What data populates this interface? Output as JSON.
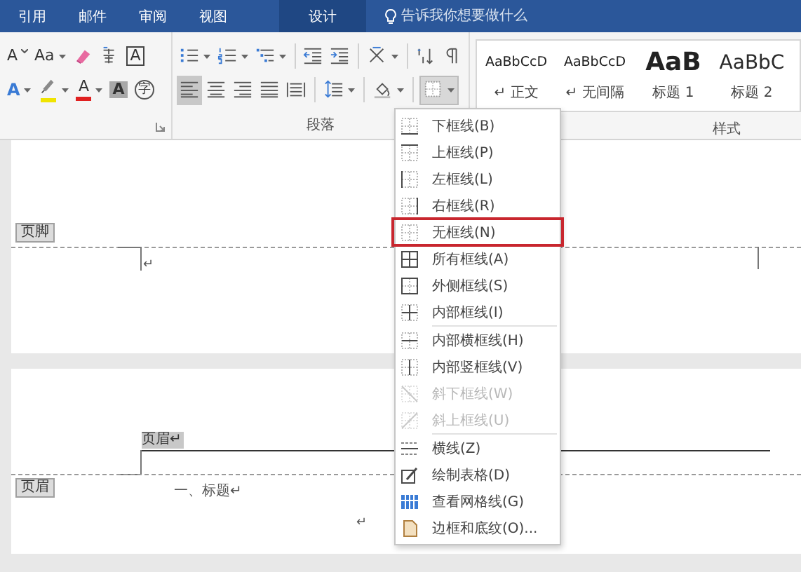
{
  "tabs": [
    {
      "label": "引用",
      "selected": false
    },
    {
      "label": "邮件",
      "selected": false
    },
    {
      "label": "审阅",
      "selected": false
    },
    {
      "label": "视图",
      "selected": false
    },
    {
      "label": "设计",
      "selected": true
    }
  ],
  "tell_me": {
    "placeholder": "告诉我你想要做什么"
  },
  "font_group": {
    "row1": [
      {
        "kind": "letter",
        "label": "A"
      },
      {
        "kind": "letter",
        "label": "Aa"
      },
      {
        "kind": "icon"
      },
      {
        "kind": "icon"
      },
      {
        "kind": "letter",
        "label": "A"
      }
    ],
    "row2": [
      {
        "kind": "letter",
        "label": "A"
      },
      {
        "kind": "icon",
        "color": "#f0e400"
      },
      {
        "kind": "letter",
        "label": "A",
        "color": "#e02020"
      },
      {
        "kind": "letter",
        "label": "A"
      },
      {
        "kind": "letter",
        "label": "字"
      }
    ]
  },
  "para_group": {
    "label": "段落",
    "alignment": [
      {
        "selected": true
      },
      {
        "selected": false
      },
      {
        "selected": false
      },
      {
        "selected": false
      },
      {
        "selected": false
      }
    ],
    "row2": [
      {
        "pressed": false
      },
      {
        "pressed": false
      },
      {
        "pressed": true
      }
    ]
  },
  "styles": {
    "label": "样式",
    "items": [
      {
        "preview": "AaBbCcD",
        "name": "↵ 正文",
        "kind": "normal"
      },
      {
        "preview": "AaBbCcD",
        "name": "↵ 无间隔",
        "kind": "normal"
      },
      {
        "preview": "AaB",
        "name": "标题 1",
        "kind": "heading1"
      },
      {
        "preview": "AaBbC",
        "name": "标题 2",
        "kind": "heading2"
      }
    ]
  },
  "document": {
    "footer_tag": "页脚",
    "footer_mark": "↵",
    "header_text": "页眉↵",
    "header_tag": "页眉",
    "heading": "一、标题↵",
    "body_mark": "↵"
  },
  "border_menu": {
    "items": [
      {
        "kind": "item",
        "label": "下框线(B)",
        "disabled": false,
        "selected": false
      },
      {
        "kind": "item",
        "label": "上框线(P)",
        "disabled": false,
        "selected": false
      },
      {
        "kind": "item",
        "label": "左框线(L)",
        "disabled": false,
        "selected": false
      },
      {
        "kind": "item",
        "label": "右框线(R)",
        "disabled": false,
        "selected": false
      },
      {
        "kind": "item",
        "label": "无框线(N)",
        "disabled": false,
        "selected": true
      },
      {
        "kind": "item",
        "label": "所有框线(A)",
        "disabled": false,
        "selected": false
      },
      {
        "kind": "item",
        "label": "外侧框线(S)",
        "disabled": false,
        "selected": false
      },
      {
        "kind": "item",
        "label": "内部框线(I)",
        "disabled": false,
        "selected": false
      },
      {
        "kind": "separator"
      },
      {
        "kind": "item",
        "label": "内部横框线(H)",
        "disabled": false,
        "selected": false
      },
      {
        "kind": "item",
        "label": "内部竖框线(V)",
        "disabled": false,
        "selected": false
      },
      {
        "kind": "item",
        "label": "斜下框线(W)",
        "disabled": true,
        "selected": false
      },
      {
        "kind": "item",
        "label": "斜上框线(U)",
        "disabled": true,
        "selected": false
      },
      {
        "kind": "separator"
      },
      {
        "kind": "item",
        "label": "横线(Z)",
        "disabled": false,
        "selected": false
      },
      {
        "kind": "item",
        "label": "绘制表格(D)",
        "disabled": false,
        "selected": false
      },
      {
        "kind": "item",
        "label": "查看网格线(G)",
        "disabled": false,
        "selected": false
      },
      {
        "kind": "item",
        "label": "边框和底纹(O)...",
        "disabled": false,
        "selected": false
      }
    ]
  }
}
